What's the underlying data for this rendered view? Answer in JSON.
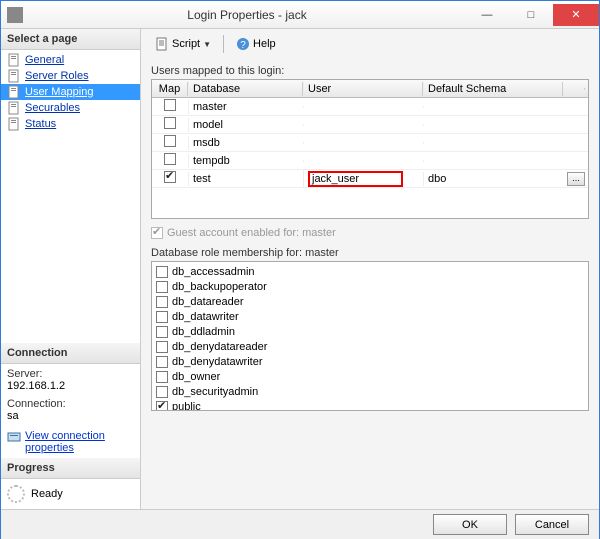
{
  "window": {
    "title": "Login Properties - jack",
    "min": "—",
    "max": "□",
    "close": "✕"
  },
  "sidebar": {
    "select_page": "Select a page",
    "items": [
      {
        "label": "General"
      },
      {
        "label": "Server Roles"
      },
      {
        "label": "User Mapping"
      },
      {
        "label": "Securables"
      },
      {
        "label": "Status"
      }
    ],
    "connection_header": "Connection",
    "server_label": "Server:",
    "server_value": "192.168.1.2",
    "conn_label": "Connection:",
    "conn_value": "sa",
    "view_conn_link": "View connection properties",
    "progress_header": "Progress",
    "progress_value": "Ready"
  },
  "toolbar": {
    "script_label": "Script",
    "help_label": "Help"
  },
  "mapping": {
    "section_label": "Users mapped to this login:",
    "headers": {
      "map": "Map",
      "db": "Database",
      "user": "User",
      "schema": "Default Schema"
    },
    "rows": [
      {
        "checked": false,
        "db": "master",
        "user": "",
        "schema": "",
        "highlight": false,
        "btn": false
      },
      {
        "checked": false,
        "db": "model",
        "user": "",
        "schema": "",
        "highlight": false,
        "btn": false
      },
      {
        "checked": false,
        "db": "msdb",
        "user": "",
        "schema": "",
        "highlight": false,
        "btn": false
      },
      {
        "checked": false,
        "db": "tempdb",
        "user": "",
        "schema": "",
        "highlight": false,
        "btn": false
      },
      {
        "checked": true,
        "db": "test",
        "user": "jack_user",
        "schema": "dbo",
        "highlight": true,
        "btn": true
      }
    ]
  },
  "guest": {
    "label": "Guest account enabled for: master",
    "checked": true,
    "disabled": true
  },
  "roles": {
    "section_label": "Database role membership for: master",
    "items": [
      {
        "name": "db_accessadmin",
        "checked": false
      },
      {
        "name": "db_backupoperator",
        "checked": false
      },
      {
        "name": "db_datareader",
        "checked": false
      },
      {
        "name": "db_datawriter",
        "checked": false
      },
      {
        "name": "db_ddladmin",
        "checked": false
      },
      {
        "name": "db_denydatareader",
        "checked": false
      },
      {
        "name": "db_denydatawriter",
        "checked": false
      },
      {
        "name": "db_owner",
        "checked": false
      },
      {
        "name": "db_securityadmin",
        "checked": false
      },
      {
        "name": "public",
        "checked": true
      }
    ]
  },
  "footer": {
    "ok": "OK",
    "cancel": "Cancel"
  }
}
